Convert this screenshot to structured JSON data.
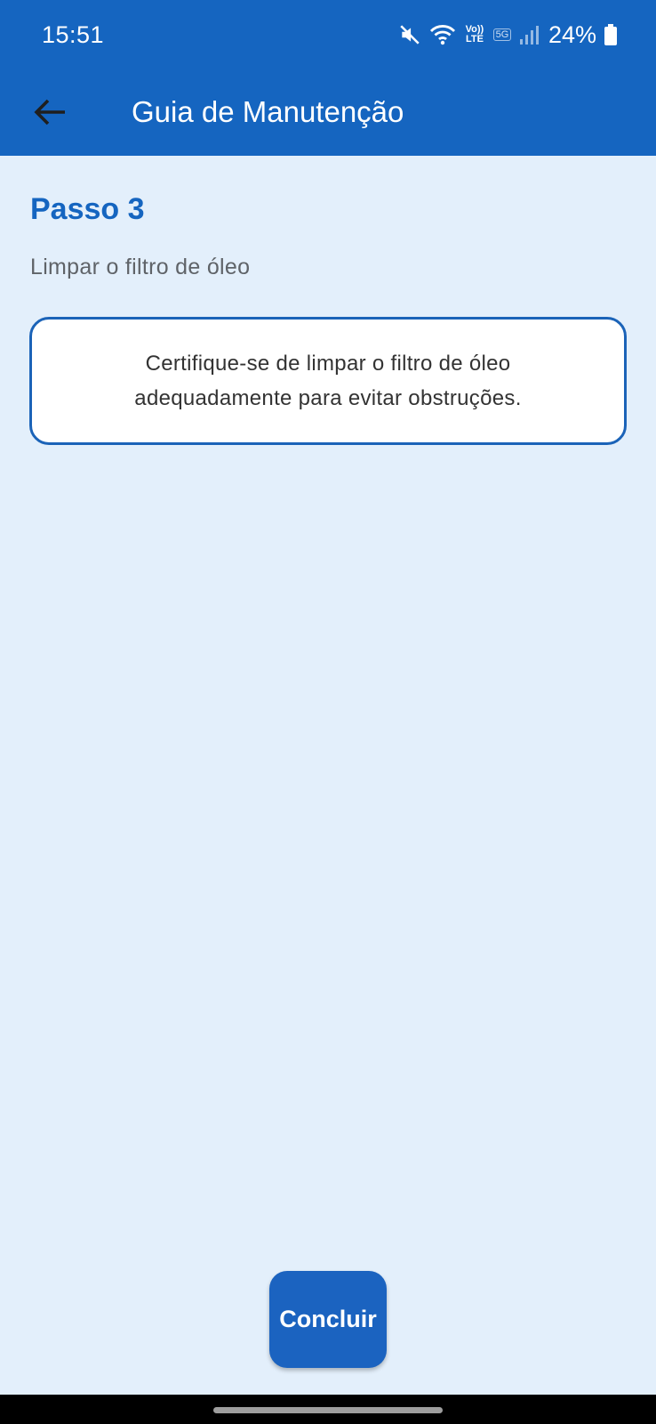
{
  "status_bar": {
    "time": "15:51",
    "volte_top": "Vo))",
    "volte_bottom": "LTE",
    "network": "5G",
    "battery": "24%"
  },
  "app_bar": {
    "title": "Guia de Manutenção",
    "back_icon": "arrow-back-icon"
  },
  "step": {
    "title": "Passo 3",
    "subtitle": "Limpar o filtro de óleo",
    "note": "Certifique-se de limpar o filtro de óleo adequadamente para evitar obstruções."
  },
  "actions": {
    "finish_label": "Concluir"
  },
  "colors": {
    "primary": "#1565c0",
    "background": "#e3effb",
    "card_border": "#1b63b8"
  }
}
